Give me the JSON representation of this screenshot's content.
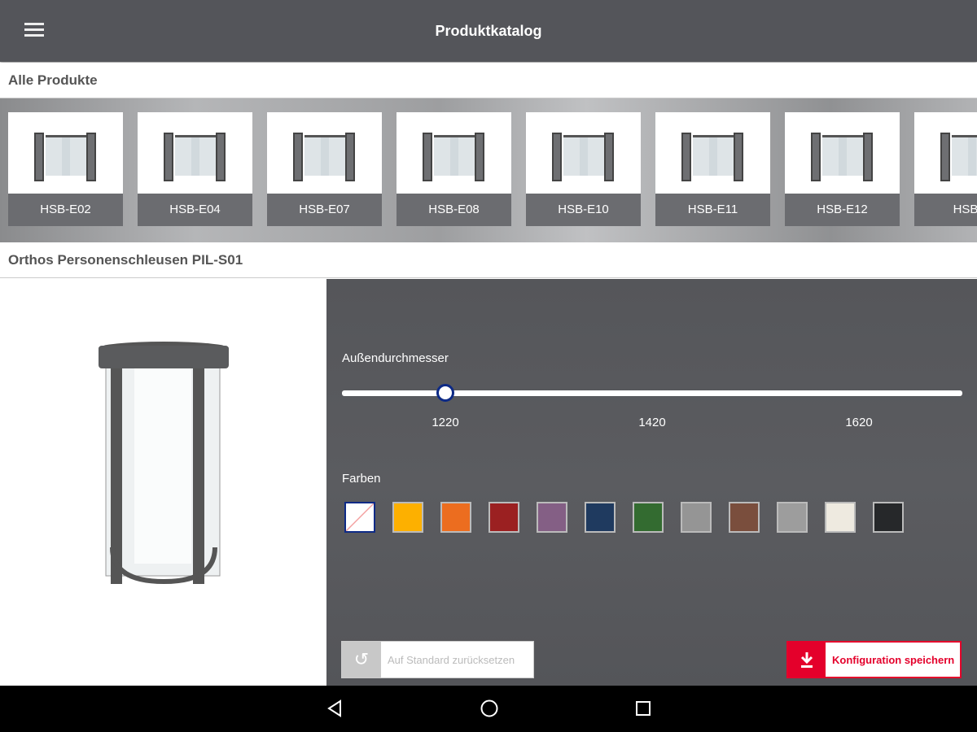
{
  "header": {
    "title": "Produktkatalog",
    "menu_icon": "hamburger-menu-icon"
  },
  "all_products": {
    "label": "Alle Produkte",
    "items": [
      "HSB-E02",
      "HSB-E04",
      "HSB-E07",
      "HSB-E08",
      "HSB-E10",
      "HSB-E11",
      "HSB-E12",
      "HSB-E"
    ]
  },
  "product": {
    "title": "Orthos Personenschleusen PIL-S01"
  },
  "config": {
    "diameter": {
      "label": "Außendurchmesser",
      "min": 1120,
      "max": 1720,
      "value": 1220,
      "ticks": [
        "1220",
        "1420",
        "1620"
      ]
    },
    "colors": {
      "label": "Farben",
      "swatches": [
        "none",
        "#fdb000",
        "#ec6d1f",
        "#9b2021",
        "#845f85",
        "#1f3a5f",
        "#336b30",
        "#959595",
        "#7a4e3d",
        "#9d9d9d",
        "#eeeae0",
        "#26282a"
      ],
      "selected": 0,
      "accent": "#0d2a86"
    },
    "reset_label": "Auf Standard zurücksetzen",
    "save_label": "Konfiguration speichern",
    "save_color": "#e4002b"
  },
  "navbar": {
    "icons": [
      "back-icon",
      "home-icon",
      "recents-icon"
    ]
  }
}
